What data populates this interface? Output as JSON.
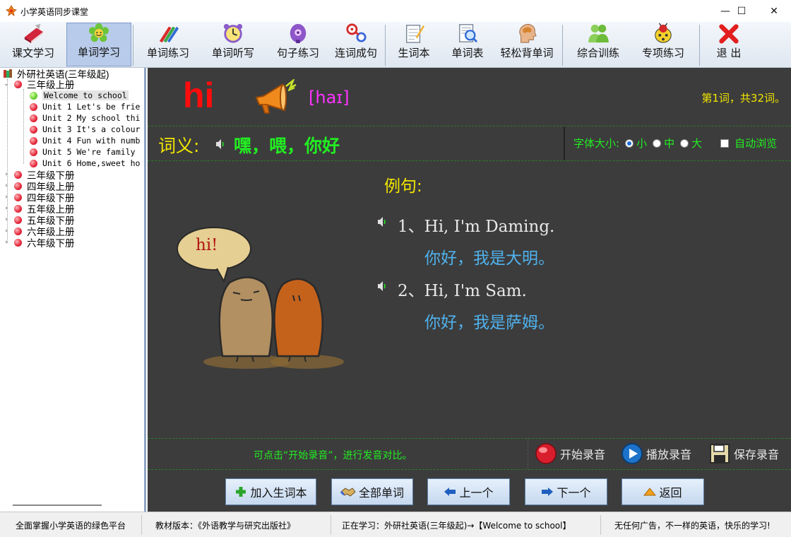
{
  "window": {
    "title": "小学英语同步课堂",
    "minimize": "—",
    "maximize": "☐",
    "close": "✕"
  },
  "toolbar": {
    "items": [
      {
        "label": "课文学习",
        "icon": "book-icon"
      },
      {
        "label": "单词学习",
        "icon": "flower-icon",
        "active": true
      },
      {
        "label": "单词练习",
        "icon": "pencils-icon"
      },
      {
        "label": "单词听写",
        "icon": "alarm-clock-icon"
      },
      {
        "label": "句子练习",
        "icon": "radio-icon"
      },
      {
        "label": "连词成句",
        "icon": "molecule-icon"
      },
      {
        "label": "生词本",
        "icon": "notepad-icon"
      },
      {
        "label": "单词表",
        "icon": "magnifier-icon"
      },
      {
        "label": "轻松背单词",
        "icon": "head-icon"
      },
      {
        "label": "综合训练",
        "icon": "people-icon"
      },
      {
        "label": "专项练习",
        "icon": "ladybug-icon"
      },
      {
        "label": "退 出",
        "icon": "exit-x-icon"
      }
    ]
  },
  "tree": {
    "root": "外研社英语(三年级起)",
    "expanded_grade": "三年级上册",
    "units": [
      "Welcome to school",
      "Unit 1 Let's be frie",
      "Unit 2 My school thi",
      "Unit 3 It's a colour",
      "Unit 4 Fun with numb",
      "Unit 5 We're family",
      "Unit 6 Home,sweet ho"
    ],
    "selected_unit": "Welcome to school",
    "other_grades": [
      "三年级下册",
      "四年级上册",
      "四年级下册",
      "五年级上册",
      "五年级下册",
      "六年级上册",
      "六年级下册"
    ]
  },
  "word": {
    "text": "hi",
    "phonetic": "[haɪ]",
    "counter": "第1词，共32词。",
    "meaning_label": "词义:",
    "meaning": "嘿，喂，你好"
  },
  "font_size": {
    "label": "字体大小:",
    "options": [
      "小",
      "中",
      "大"
    ],
    "selected": "小",
    "auto_browse": "自动浏览"
  },
  "examples": {
    "label": "例句:",
    "items": [
      {
        "en": "1、Hi, I'm Daming.",
        "cn": "你好，我是大明。"
      },
      {
        "en": "2、Hi, I'm Sam.",
        "cn": "你好，我是萨姆。"
      }
    ]
  },
  "illustration": {
    "bubble": "hi!"
  },
  "recording": {
    "hint": "可点击“开始录音”，进行发音对比。",
    "start": "开始录音",
    "play": "播放录音",
    "save": "保存录音"
  },
  "nav": {
    "add": "加入生词本",
    "all": "全部单词",
    "prev": "上一个",
    "next": "下一个",
    "back": "返回"
  },
  "status": {
    "slogan": "全面掌握小学英语的绿色平台",
    "edition": "教材版本：《外语教学与研究出版社》",
    "learning": "正在学习：外研社英语(三年级起)→【Welcome to school】",
    "ad": "无任何广告，不一样的英语，快乐的学习!"
  },
  "colors": {
    "word": "#ff0c0c",
    "phonetic": "#ff33ff",
    "yellow": "#f2e600",
    "green": "#22ee22",
    "blue_cn": "#4fb2ee",
    "panel_bg": "#3c3c3c"
  }
}
